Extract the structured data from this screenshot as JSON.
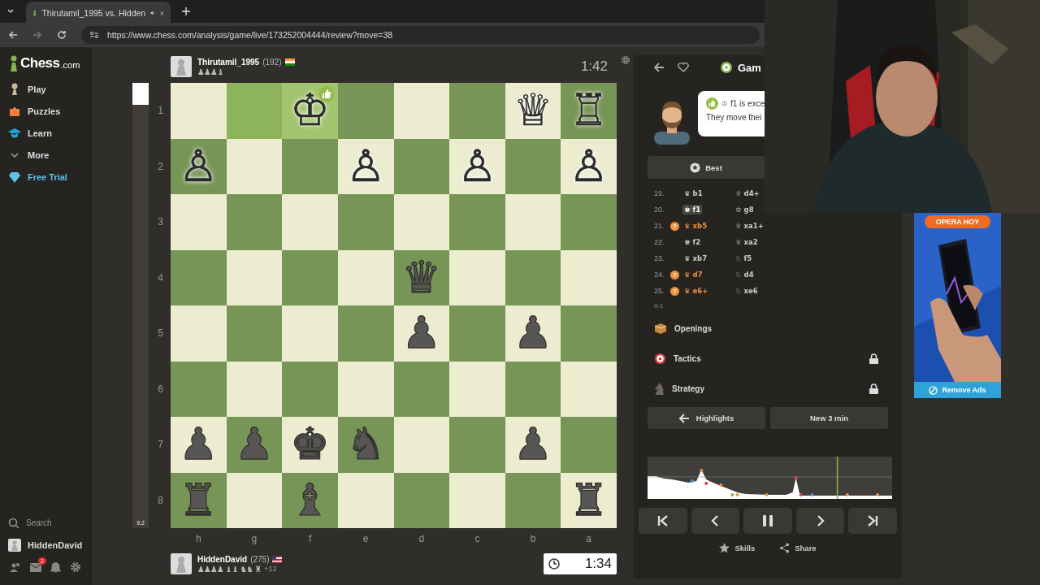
{
  "browser": {
    "tab_title": "Thirutamil_1995 vs. Hidden",
    "url": "https://www.chess.com/analysis/game/live/173252004444/review?move=38"
  },
  "sidebar": {
    "logo": "Chess",
    "logo_suffix": ".com",
    "items": [
      {
        "label": "Play",
        "kind": "play"
      },
      {
        "label": "Puzzles",
        "kind": "puzzles"
      },
      {
        "label": "Learn",
        "kind": "learn"
      },
      {
        "label": "More",
        "kind": "more"
      },
      {
        "label": "Free Trial",
        "kind": "trial"
      }
    ],
    "search": "Search",
    "user": "HiddenDavid",
    "message_badge": "2"
  },
  "top_player": {
    "name": "Thirutamil_1995",
    "rating": "(192)",
    "captured": "♟♟♟♝",
    "clock": "1:42",
    "active": false
  },
  "bottom_player": {
    "name": "HiddenDavid",
    "rating": "(275)",
    "captured": "♟♟♟♟ ♝♝ ♞♞ ♜",
    "advantage": "+12",
    "clock": "1:34",
    "active": true
  },
  "eval_bar": {
    "level": 0.05,
    "reading": "9.2"
  },
  "board": {
    "ranks": [
      "1",
      "2",
      "3",
      "4",
      "5",
      "6",
      "7",
      "8"
    ],
    "files": [
      "h",
      "g",
      "f",
      "e",
      "d",
      "c",
      "b",
      "a"
    ],
    "rows": [
      [
        {
          "highlighted": false
        },
        {
          "highlighted": true
        },
        {
          "piece": "♔",
          "white": true,
          "highlighted": true,
          "excellent": true
        },
        {
          "highlighted": false
        },
        {
          "highlighted": false
        },
        {
          "highlighted": false
        },
        {
          "piece": "♕",
          "white": true,
          "highlighted": false
        },
        {
          "piece": "♖",
          "white": true,
          "highlighted": false
        }
      ],
      [
        {
          "piece": "♙",
          "white": true,
          "highlighted": false
        },
        {
          "highlighted": false
        },
        {
          "highlighted": false
        },
        {
          "piece": "♙",
          "white": true,
          "highlighted": false
        },
        {
          "highlighted": false
        },
        {
          "piece": "♙",
          "white": true,
          "highlighted": false
        },
        {
          "highlighted": false
        },
        {
          "piece": "♙",
          "white": true,
          "highlighted": false
        }
      ],
      [
        {
          "highlighted": false
        },
        {
          "highlighted": false
        },
        {
          "highlighted": false
        },
        {
          "highlighted": false
        },
        {
          "highlighted": false
        },
        {
          "highlighted": false
        },
        {
          "highlighted": false
        },
        {
          "highlighted": false
        }
      ],
      [
        {
          "highlighted": false
        },
        {
          "highlighted": false
        },
        {
          "highlighted": false
        },
        {
          "highlighted": false
        },
        {
          "piece": "♛",
          "white": false,
          "highlighted": false
        },
        {
          "highlighted": false
        },
        {
          "highlighted": false
        },
        {
          "highlighted": false
        }
      ],
      [
        {
          "highlighted": false
        },
        {
          "highlighted": false
        },
        {
          "highlighted": false
        },
        {
          "highlighted": false
        },
        {
          "piece": "♟",
          "white": false,
          "highlighted": false
        },
        {
          "highlighted": false
        },
        {
          "piece": "♟",
          "white": false,
          "highlighted": false
        },
        {
          "highlighted": false
        }
      ],
      [
        {
          "highlighted": false
        },
        {
          "highlighted": false
        },
        {
          "highlighted": false
        },
        {
          "highlighted": false
        },
        {
          "highlighted": false
        },
        {
          "highlighted": false
        },
        {
          "highlighted": false
        },
        {
          "highlighted": false
        }
      ],
      [
        {
          "piece": "♟",
          "white": false,
          "highlighted": false
        },
        {
          "piece": "♟",
          "white": false,
          "highlighted": false
        },
        {
          "piece": "♚",
          "white": false,
          "highlighted": false
        },
        {
          "piece": "♞",
          "white": false,
          "highlighted": false
        },
        {
          "highlighted": false
        },
        {
          "highlighted": false
        },
        {
          "piece": "♟",
          "white": false,
          "highlighted": false
        },
        {
          "highlighted": false
        }
      ],
      [
        {
          "piece": "♜",
          "white": false,
          "highlighted": false
        },
        {
          "highlighted": false
        },
        {
          "piece": "♝",
          "white": false,
          "highlighted": false
        },
        {
          "highlighted": false
        },
        {
          "highlighted": false
        },
        {
          "highlighted": false
        },
        {
          "highlighted": false
        },
        {
          "piece": "♜",
          "white": false,
          "highlighted": false
        }
      ]
    ]
  },
  "review": {
    "title": "Gam",
    "coach_piece": "♔",
    "coach_headline": "f1 is exce",
    "coach_text": "They move thei",
    "best_button": "Best",
    "moves": [
      {
        "number": "19.",
        "white": {
          "piece": "♛",
          "san": "b1",
          "inaccuracy": false,
          "selected": false
        },
        "black": {
          "piece": "♕",
          "san": "d4+",
          "inaccuracy": false,
          "selected": false
        }
      },
      {
        "number": "20.",
        "white": {
          "piece": "♚",
          "san": "f1",
          "inaccuracy": false,
          "selected": true
        },
        "black": {
          "piece": "♔",
          "san": "g8",
          "inaccuracy": false,
          "selected": false
        }
      },
      {
        "number": "21.",
        "white": {
          "piece": "♛",
          "san": "xb5",
          "inaccuracy": true,
          "badge": "?",
          "selected": false
        },
        "black": {
          "piece": "♕",
          "san": "xa1+",
          "inaccuracy": false,
          "selected": false
        }
      },
      {
        "number": "22.",
        "white": {
          "piece": "♚",
          "san": "f2",
          "inaccuracy": false,
          "selected": false
        },
        "black": {
          "piece": "♕",
          "san": "xa2",
          "inaccuracy": false,
          "selected": false
        }
      },
      {
        "number": "23.",
        "white": {
          "piece": "♛",
          "san": "xb7",
          "inaccuracy": false,
          "selected": false
        },
        "black": {
          "piece": "♘",
          "san": "f5",
          "inaccuracy": false,
          "selected": false
        }
      },
      {
        "number": "24.",
        "white": {
          "piece": "♛",
          "san": "d7",
          "inaccuracy": true,
          "badge": "?",
          "selected": false
        },
        "black": {
          "piece": "♘",
          "san": "d4",
          "inaccuracy": false,
          "selected": false
        }
      },
      {
        "number": "25.",
        "white": {
          "piece": "♛",
          "san": "e6+",
          "inaccuracy": true,
          "badge": "?",
          "selected": false
        },
        "black": {
          "piece": "♘",
          "san": "xe6",
          "inaccuracy": false,
          "selected": false
        }
      }
    ],
    "result": "0-1",
    "sections": [
      {
        "label": "Openings",
        "kind": "openings",
        "locked": false
      },
      {
        "label": "Tactics",
        "kind": "tactics",
        "locked": true
      },
      {
        "label": "Strategy",
        "kind": "strategy",
        "locked": true
      }
    ],
    "highlights_button": "Highlights",
    "next_button": "New 3 min",
    "footer": [
      {
        "label": "Skills",
        "kind": "skills"
      },
      {
        "label": "Share",
        "kind": "share"
      }
    ]
  },
  "ad": {
    "cta": "OPERA HOY",
    "remove": "Remove Ads"
  }
}
